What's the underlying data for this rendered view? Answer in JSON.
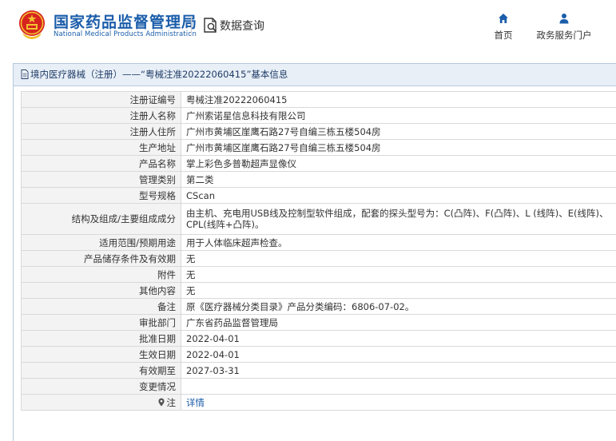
{
  "header": {
    "org_name_cn": "国家药品监督管理局",
    "org_name_en": "National Medical Products Administration",
    "query_label": "数据查询",
    "nav": {
      "home": "首页",
      "gov_portal": "政务服务门户"
    }
  },
  "panel": {
    "title": "境内医疗器械（注册）——“粤械注准20222060415”基本信息"
  },
  "rows": [
    {
      "label": "注册证编号",
      "value": "粤械注准20222060415"
    },
    {
      "label": "注册人名称",
      "value": "广州索诺星信息科技有限公司"
    },
    {
      "label": "注册人住所",
      "value": "广州市黄埔区崖鹰石路27号自编三栋五楼504房"
    },
    {
      "label": "生产地址",
      "value": "广州市黄埔区崖鹰石路27号自编三栋五楼504房"
    },
    {
      "label": "产品名称",
      "value": "掌上彩色多普勒超声显像仪"
    },
    {
      "label": "管理类别",
      "value": "第二类"
    },
    {
      "label": "型号规格",
      "value": "CScan"
    },
    {
      "label": "结构及组成/主要组成成分",
      "value": "由主机、充电用USB线及控制型软件组成，配套的探头型号为：C(凸阵)、F(凸阵)、L (线阵)、E(线阵)、CPL(线阵+凸阵)。"
    },
    {
      "label": "适用范围/预期用途",
      "value": "用于人体临床超声检查。"
    },
    {
      "label": "产品储存条件及有效期",
      "value": "无"
    },
    {
      "label": "附件",
      "value": "无"
    },
    {
      "label": "其他内容",
      "value": "无"
    },
    {
      "label": "备注",
      "value": "原《医疗器械分类目录》产品分类编码：6806-07-02。"
    },
    {
      "label": "审批部门",
      "value": "广东省药品监督管理局"
    },
    {
      "label": "批准日期",
      "value": "2022-04-01"
    },
    {
      "label": "生效日期",
      "value": "2022-04-01"
    },
    {
      "label": "有效期至",
      "value": "2027-03-31"
    },
    {
      "label": "变更情况",
      "value": ""
    }
  ],
  "note_row": {
    "label": "注",
    "link": "详情"
  },
  "colors": {
    "brand_blue": "#1a5daa",
    "title_bar_bg": "#e8eff7",
    "label_bg": "#f3f3f3",
    "emblem_red": "#d7231e",
    "emblem_gold": "#f2c230"
  },
  "icons": {
    "emblem": "national-emblem-icon",
    "query": "document-search-icon",
    "home": "home-icon",
    "gov": "user-icon",
    "title": "document-icon",
    "note": "map-pin-icon"
  }
}
